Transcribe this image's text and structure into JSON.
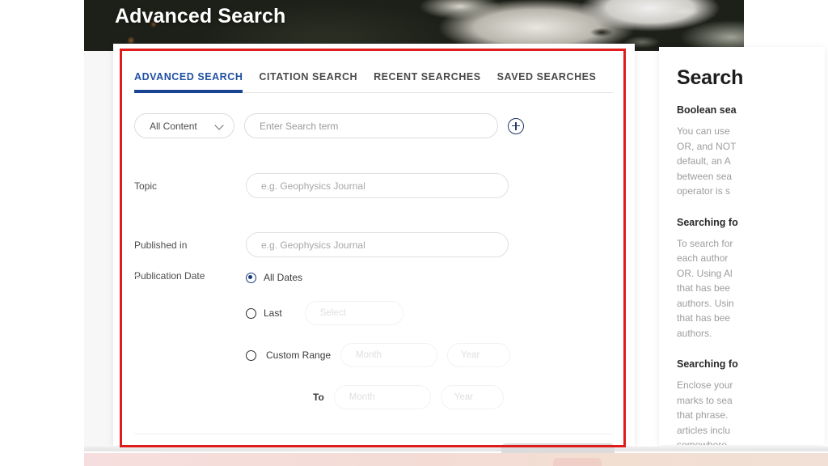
{
  "hero": {
    "title": "Advanced Search"
  },
  "tabs": [
    {
      "label": "ADVANCED SEARCH",
      "active": true
    },
    {
      "label": "CITATION SEARCH",
      "active": false
    },
    {
      "label": "RECENT SEARCHES",
      "active": false
    },
    {
      "label": "SAVED SEARCHES",
      "active": false
    }
  ],
  "query_row": {
    "scope_value": "All Content",
    "search_placeholder": "Enter Search term",
    "add_row_icon": "plus-circle-icon",
    "chevron_icon": "chevron-down-icon"
  },
  "form": {
    "topic": {
      "label": "Topic",
      "placeholder": "e.g. Geophysics Journal"
    },
    "published_in": {
      "label": "Published in",
      "placeholder": "e.g. Geophysics Journal"
    },
    "publication_date": {
      "label": "Publication Date",
      "options": [
        {
          "label": "All Dates",
          "checked": true
        },
        {
          "label": "Last",
          "checked": false
        },
        {
          "label": "Custom Range",
          "checked": false
        }
      ],
      "last_select_placeholder": "Select",
      "range_from_month": "Month",
      "range_from_year": "Year",
      "to_label": "To",
      "range_to_month": "Month",
      "range_to_year": "Year"
    }
  },
  "help": {
    "title": "Search",
    "sections": [
      {
        "heading": "Boolean sea",
        "body": "You can use\nOR, and NOT\ndefault, an A\nbetween sea\noperator is s"
      },
      {
        "heading": "Searching fo",
        "body": "To search for\neach author\nOR. Using Al\nthat has bee\nauthors. Usin\nthat has bee\nauthors."
      },
      {
        "heading": "Searching fo",
        "body": "Enclose your\nmarks to sea\nthat phrase.\narticles inclu\nsomewhere\nFor example"
      }
    ]
  },
  "annotation": {
    "box_color": "#e01b1b"
  },
  "colors": {
    "active_tab": "#1f4fa3",
    "tab_underline": "#1a4593",
    "radio_checked": "#1b3a77",
    "plus_icon": "#253a66"
  }
}
